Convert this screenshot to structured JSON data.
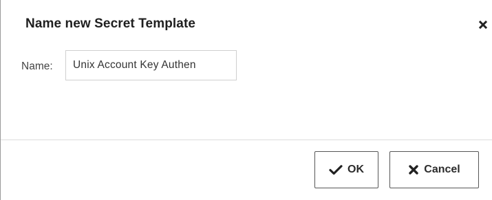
{
  "dialog": {
    "title": "Name new Secret Template",
    "close_icon": "close-icon"
  },
  "form": {
    "name_label": "Name:",
    "name_value": "Unix Account Key Authen"
  },
  "footer": {
    "ok_label": "OK",
    "ok_icon": "checkmark-icon",
    "cancel_label": "Cancel",
    "cancel_icon": "x-icon"
  }
}
